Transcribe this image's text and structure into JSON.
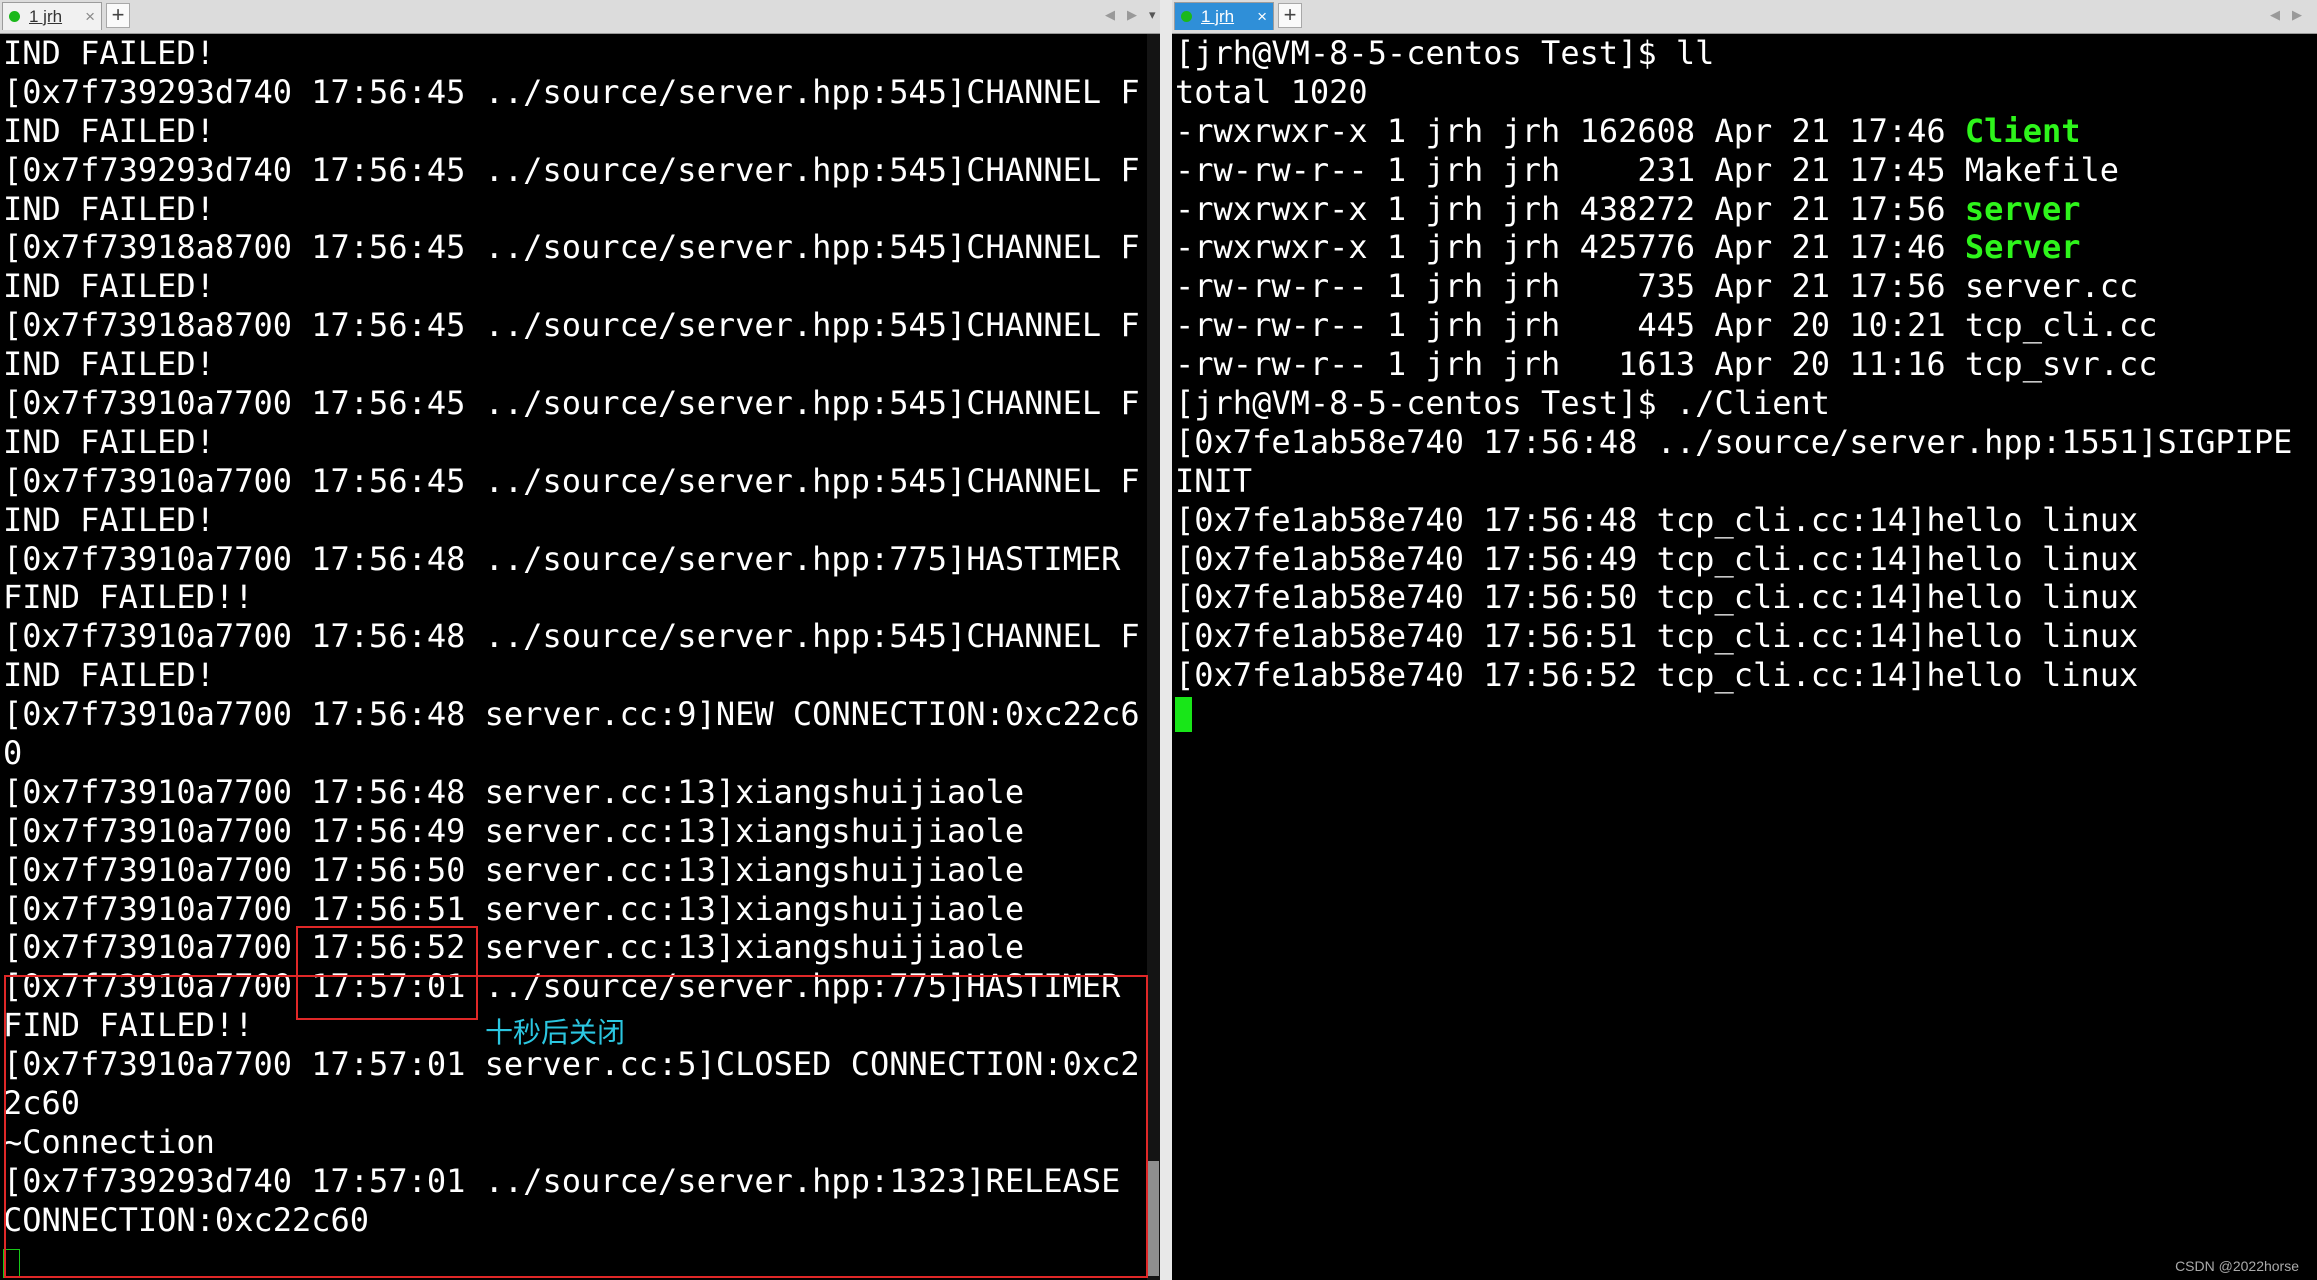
{
  "tabs": {
    "left": {
      "label": "1 jrh",
      "close": "×",
      "add": "+"
    },
    "right": {
      "label": "1 jrh",
      "close": "×",
      "add": "+"
    }
  },
  "left_terminal": {
    "lines": [
      "IND FAILED!",
      "[0x7f739293d740 17:56:45 ../source/server.hpp:545]CHANNEL F",
      "IND FAILED!",
      "[0x7f739293d740 17:56:45 ../source/server.hpp:545]CHANNEL F",
      "IND FAILED!",
      "[0x7f73918a8700 17:56:45 ../source/server.hpp:545]CHANNEL F",
      "IND FAILED!",
      "[0x7f73918a8700 17:56:45 ../source/server.hpp:545]CHANNEL F",
      "IND FAILED!",
      "[0x7f73910a7700 17:56:45 ../source/server.hpp:545]CHANNEL F",
      "IND FAILED!",
      "[0x7f73910a7700 17:56:45 ../source/server.hpp:545]CHANNEL F",
      "IND FAILED!",
      "[0x7f73910a7700 17:56:48 ../source/server.hpp:775]HASTIMER",
      "FIND FAILED!!",
      "[0x7f73910a7700 17:56:48 ../source/server.hpp:545]CHANNEL F",
      "IND FAILED!",
      "[0x7f73910a7700 17:56:48 server.cc:9]NEW CONNECTION:0xc22c6",
      "0",
      "[0x7f73910a7700 17:56:48 server.cc:13]xiangshuijiaole",
      "[0x7f73910a7700 17:56:49 server.cc:13]xiangshuijiaole",
      "[0x7f73910a7700 17:56:50 server.cc:13]xiangshuijiaole",
      "[0x7f73910a7700 17:56:51 server.cc:13]xiangshuijiaole",
      "[0x7f73910a7700 17:56:52 server.cc:13]xiangshuijiaole",
      "[0x7f73910a7700 17:57:01 ../source/server.hpp:775]HASTIMER",
      "FIND FAILED!!",
      "[0x7f73910a7700 17:57:01 server.cc:5]CLOSED CONNECTION:0xc2",
      "2c60",
      "~Connection",
      "[0x7f739293d740 17:57:01 ../source/server.hpp:1323]RELEASE",
      "CONNECTION:0xc22c60"
    ],
    "annotation": "十秒后关闭"
  },
  "right_terminal": {
    "prompt_1": "[jrh@VM-8-5-centos Test]$ ll",
    "total": "total 1020",
    "listing": [
      {
        "prefix": "-rwxrwxr-x 1 jrh jrh 162608 Apr 21 17:46 ",
        "name": "Client",
        "executable": true
      },
      {
        "prefix": "-rw-rw-r-- 1 jrh jrh    231 Apr 21 17:45 ",
        "name": "Makefile",
        "executable": false
      },
      {
        "prefix": "-rwxrwxr-x 1 jrh jrh 438272 Apr 21 17:56 ",
        "name": "server",
        "executable": true
      },
      {
        "prefix": "-rwxrwxr-x 1 jrh jrh 425776 Apr 21 17:46 ",
        "name": "Server",
        "executable": true
      },
      {
        "prefix": "-rw-rw-r-- 1 jrh jrh    735 Apr 21 17:56 ",
        "name": "server.cc",
        "executable": false
      },
      {
        "prefix": "-rw-rw-r-- 1 jrh jrh    445 Apr 20 10:21 ",
        "name": "tcp_cli.cc",
        "executable": false
      },
      {
        "prefix": "-rw-rw-r-- 1 jrh jrh   1613 Apr 20 11:16 ",
        "name": "tcp_svr.cc",
        "executable": false
      }
    ],
    "output": [
      "[jrh@VM-8-5-centos Test]$ ./Client",
      "[0x7fe1ab58e740 17:56:48 ../source/server.hpp:1551]SIGPIPE",
      "INIT",
      "[0x7fe1ab58e740 17:56:48 tcp_cli.cc:14]hello linux",
      "[0x7fe1ab58e740 17:56:49 tcp_cli.cc:14]hello linux",
      "[0x7fe1ab58e740 17:56:50 tcp_cli.cc:14]hello linux",
      "[0x7fe1ab58e740 17:56:51 tcp_cli.cc:14]hello linux",
      "[0x7fe1ab58e740 17:56:52 tcp_cli.cc:14]hello linux"
    ]
  },
  "watermark": "CSDN @2022horse",
  "colors": {
    "background": "#000000",
    "text": "#ffffff",
    "executable": "#2ef51b",
    "highlight_box": "#e02828",
    "annotation": "#2bc6e0",
    "active_tab": "#2f8fd8"
  }
}
